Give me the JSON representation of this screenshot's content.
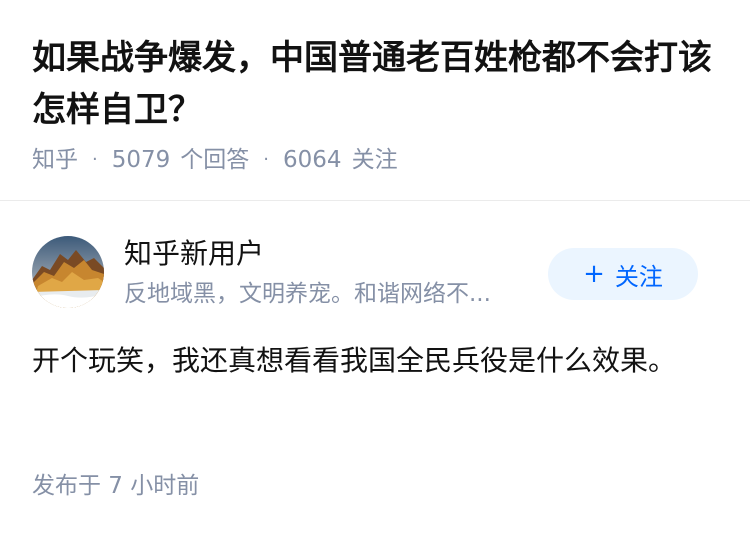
{
  "question": {
    "title": "如果战争爆发，中国普通老百姓枪都不会打该怎样自卫？",
    "source": "知乎",
    "answer_count": "5079",
    "answer_label": "个回答",
    "follower_count": "6064",
    "follower_label": "关注"
  },
  "author": {
    "name": "知乎新用户",
    "bio": "反地域黑，文明养宠。和谐网络不...",
    "follow_label": "关注",
    "follow_icon": "plus-icon"
  },
  "answer": {
    "content": "开个玩笑，我还真想看看我国全民兵役是什么效果。",
    "time": "发布于 7 小时前"
  },
  "colors": {
    "title": "#121212",
    "meta": "#8590a6",
    "accent": "#0066ff",
    "follow_bg": "#ebf5ff"
  }
}
